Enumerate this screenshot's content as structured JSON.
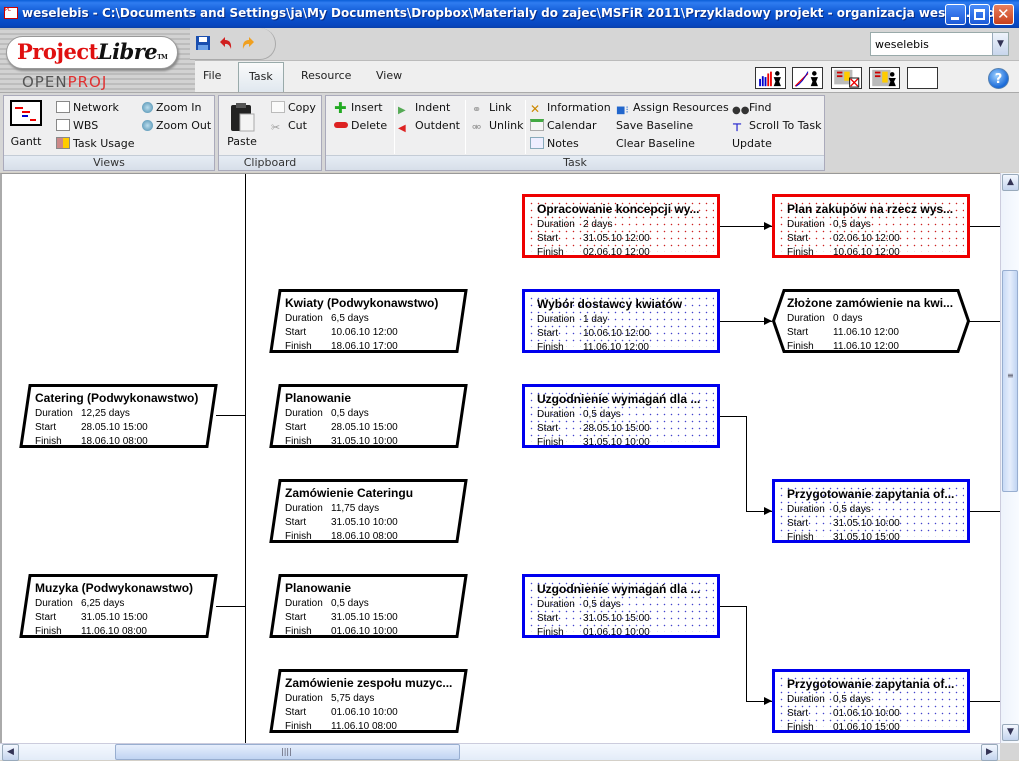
{
  "window": {
    "title": "weselebis - C:\\Documents and Settings\\ja\\My Documents\\Dropbox\\Materialy do zajec\\MSFiR 2011\\Przykladowy projekt - organizacja wesela.pod *",
    "minimize_icon": "minimize-icon",
    "maximize_icon": "maximize-icon",
    "close_icon": "close-icon"
  },
  "logo": {
    "brand": "Project",
    "brand_italic": "Libre",
    "tm": "TM",
    "sub_left": "OPEN",
    "sub_right": "PROJ"
  },
  "quick_access": [
    "save-icon",
    "undo-icon",
    "redo-icon"
  ],
  "menu": {
    "tabs": [
      "File",
      "Task",
      "Resource",
      "View"
    ],
    "active": "Task"
  },
  "project_selector": {
    "value": "weselebis"
  },
  "toolbar_icons": [
    "resource-histogram-icon",
    "resource-chart-icon",
    "task-usage-delete-icon",
    "resource-usage-icon",
    "blank-view-icon"
  ],
  "help": {
    "label": "?"
  },
  "ribbon": {
    "views": {
      "label": "Views",
      "gantt": "Gantt",
      "network": "Network",
      "wbs": "WBS",
      "task_usage": "Task Usage",
      "zoom_in": "Zoom In",
      "zoom_out": "Zoom Out"
    },
    "clipboard": {
      "label": "Clipboard",
      "paste": "Paste",
      "copy": "Copy",
      "cut": "Cut"
    },
    "task": {
      "label": "Task",
      "insert": "Insert",
      "delete": "Delete",
      "indent": "Indent",
      "outdent": "Outdent",
      "link": "Link",
      "unlink": "Unlink",
      "information": "Information",
      "calendar": "Calendar",
      "notes": "Notes",
      "assign_resources": "Assign Resources",
      "save_baseline": "Save Baseline",
      "clear_baseline": "Clear Baseline",
      "find": "Find",
      "scroll_to_task": "Scroll To Task",
      "update": "Update"
    }
  },
  "field_labels": {
    "duration": "Duration",
    "start": "Start",
    "finish": "Finish"
  },
  "nodes": [
    {
      "id": "catering",
      "type": "summary",
      "name": "Catering (Podwykonawstwo)",
      "duration": "12,25 days",
      "start": "28.05.10 15:00",
      "finish": "18.06.10 08:00"
    },
    {
      "id": "muzyka",
      "type": "summary",
      "name": "Muzyka (Podwykonawstwo)",
      "duration": "6,25 days",
      "start": "31.05.10 15:00",
      "finish": "11.06.10 08:00"
    },
    {
      "id": "kwiaty",
      "type": "summary",
      "name": "Kwiaty (Podwykonawstwo)",
      "duration": "6,5 days",
      "start": "10.06.10 12:00",
      "finish": "18.06.10 17:00"
    },
    {
      "id": "planowanie1",
      "type": "summary",
      "name": "Planowanie",
      "duration": "0,5 days",
      "start": "28.05.10 15:00",
      "finish": "31.05.10 10:00"
    },
    {
      "id": "zamowienie-cateringu",
      "type": "summary",
      "name": "Zamówienie Cateringu",
      "duration": "11,75 days",
      "start": "31.05.10 10:00",
      "finish": "18.06.10 08:00"
    },
    {
      "id": "planowanie2",
      "type": "summary",
      "name": "Planowanie",
      "duration": "0,5 days",
      "start": "31.05.10 15:00",
      "finish": "01.06.10 10:00"
    },
    {
      "id": "zamowienie-zespolu",
      "type": "summary",
      "name": "Zamówienie zespołu muzyc...",
      "duration": "5,75 days",
      "start": "01.06.10 10:00",
      "finish": "11.06.10 08:00"
    },
    {
      "id": "opracowanie",
      "type": "critical",
      "name": "Opracowanie koncepcji wy...",
      "duration": "2 days",
      "start": "31.05.10 12:00",
      "finish": "02.06.10 12:00"
    },
    {
      "id": "plan-zakupow",
      "type": "critical",
      "name": "Plan zakupów na rzecz wys...",
      "duration": "0,5 days",
      "start": "02.06.10 12:00",
      "finish": "10.06.10 12:00"
    },
    {
      "id": "wybor-dostawcy",
      "type": "task",
      "name": "Wybór dostawcy kwiatów",
      "duration": "1 day",
      "start": "10.06.10 12:00",
      "finish": "11.06.10 12:00"
    },
    {
      "id": "zlozone-zamowienie",
      "type": "milestone",
      "name": "Złożone zamówienie na kwi...",
      "duration": "0 days",
      "start": "11.06.10 12:00",
      "finish": "11.06.10 12:00"
    },
    {
      "id": "uzgodnienie1",
      "type": "task",
      "name": "Uzgodnienie wymagań dla ...",
      "duration": "0,5 days",
      "start": "28.05.10 15:00",
      "finish": "31.05.10 10:00"
    },
    {
      "id": "przygotowanie1",
      "type": "task",
      "name": "Przygotowanie zapytania of...",
      "duration": "0,5 days",
      "start": "31.05.10 10:00",
      "finish": "31.05.10 15:00"
    },
    {
      "id": "uzgodnienie2",
      "type": "task",
      "name": "Uzgodnienie wymagań dla ...",
      "duration": "0,5 days",
      "start": "31.05.10 15:00",
      "finish": "01.06.10 10:00"
    },
    {
      "id": "przygotowanie2",
      "type": "task",
      "name": "Przygotowanie zapytania of...",
      "duration": "0,5 days",
      "start": "01.06.10 10:00",
      "finish": "01.06.10 15:00"
    }
  ],
  "colors": {
    "critical": "#ee0000",
    "normal": "#0000ee",
    "summary": "#000000"
  }
}
